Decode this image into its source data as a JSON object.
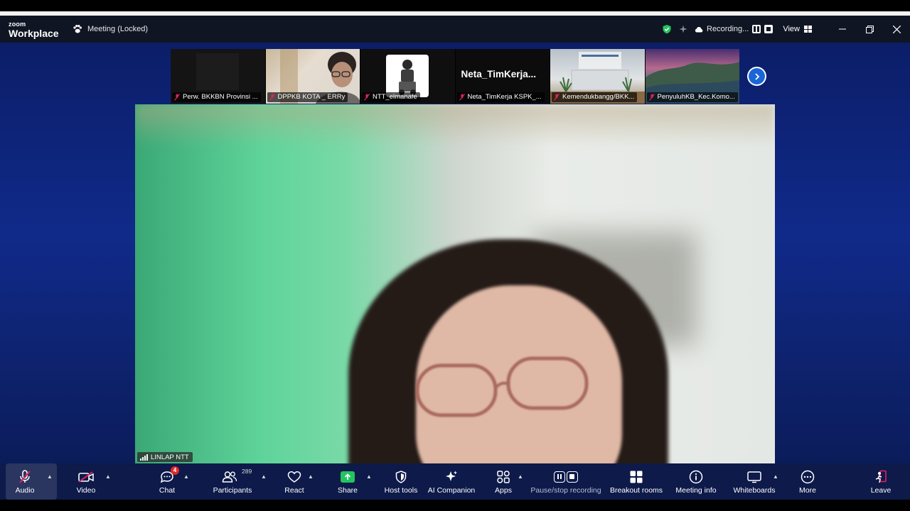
{
  "titlebar": {
    "brand_small": "zoom",
    "brand_large": "Workplace",
    "meeting_status": "Meeting (Locked)",
    "recording_label": "Recording...",
    "view_label": "View"
  },
  "thumbnails": [
    {
      "name": "Perw. BKKBN Provinsi ...",
      "muted": true
    },
    {
      "name": "DPPKB KOTA _ ERRy",
      "muted": true
    },
    {
      "name": "NTT_elmanafe",
      "muted": true
    },
    {
      "name": "Neta_TimKerja KSPK_...",
      "muted": true,
      "display_name": "Neta_TimKerja..."
    },
    {
      "name": "Kemendukbangg/BKK...",
      "muted": true
    },
    {
      "name": "PenyuluhKB_Kec.Komo...",
      "muted": true
    }
  ],
  "main_video": {
    "speaker": "LINLAP NTT"
  },
  "toolbar": {
    "audio": "Audio",
    "video": "Video",
    "chat": "Chat",
    "chat_badge": "4",
    "participants": "Participants",
    "participants_count": "289",
    "react": "React",
    "share": "Share",
    "host_tools": "Host tools",
    "ai_companion": "AI Companion",
    "apps": "Apps",
    "recording": "Pause/stop recording",
    "breakout": "Breakout rooms",
    "meeting_info": "Meeting info",
    "whiteboards": "Whiteboards",
    "more": "More",
    "leave": "Leave"
  },
  "colors": {
    "share_green": "#22c55e",
    "mute_red": "#e0245e",
    "badge_red": "#e02828",
    "next_blue": "#1a66d6",
    "leave_red": "#e0245e"
  },
  "icons": [
    "paw-icon",
    "shield-check-icon",
    "sparkle-icon",
    "cloud-icon",
    "pause-icon",
    "stop-icon",
    "grid-view-icon",
    "minimize-icon",
    "restore-icon",
    "close-icon",
    "mic-muted-icon",
    "camera-off-icon",
    "chat-icon",
    "participants-icon",
    "heart-icon",
    "share-arrow-icon",
    "shield-icon",
    "ai-sparkle-icon",
    "apps-icon",
    "record-icon",
    "breakout-icon",
    "info-icon",
    "whiteboard-icon",
    "more-icon",
    "leave-icon",
    "chevron-right-icon",
    "signal-bars-icon"
  ]
}
